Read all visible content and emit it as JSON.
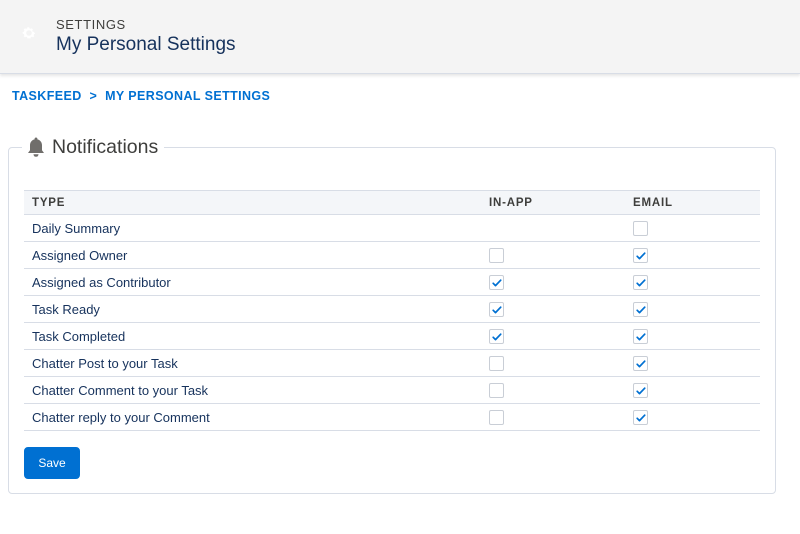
{
  "header": {
    "kicker": "SETTINGS",
    "title": "My Personal Settings",
    "icon": "gear-icon"
  },
  "breadcrumb": {
    "items": [
      "TASKFEED",
      "MY PERSONAL SETTINGS"
    ],
    "separator": ">"
  },
  "notifications": {
    "legend": "Notifications",
    "icon": "bell-icon",
    "columns": [
      "TYPE",
      "IN-APP",
      "EMAIL"
    ],
    "rows": [
      {
        "type": "Daily Summary",
        "in_app": null,
        "email": false
      },
      {
        "type": "Assigned Owner",
        "in_app": false,
        "email": true
      },
      {
        "type": "Assigned as Contributor",
        "in_app": true,
        "email": true
      },
      {
        "type": "Task Ready",
        "in_app": true,
        "email": true
      },
      {
        "type": "Task Completed",
        "in_app": true,
        "email": true
      },
      {
        "type": "Chatter Post to your Task",
        "in_app": false,
        "email": true
      },
      {
        "type": "Chatter Comment to your Task",
        "in_app": false,
        "email": true
      },
      {
        "type": "Chatter reply to your Comment",
        "in_app": false,
        "email": true
      }
    ]
  },
  "actions": {
    "save_label": "Save"
  },
  "colors": {
    "brand_blue": "#0070d2",
    "header_bg": "#f4f4f4",
    "border": "#d8dde6"
  }
}
